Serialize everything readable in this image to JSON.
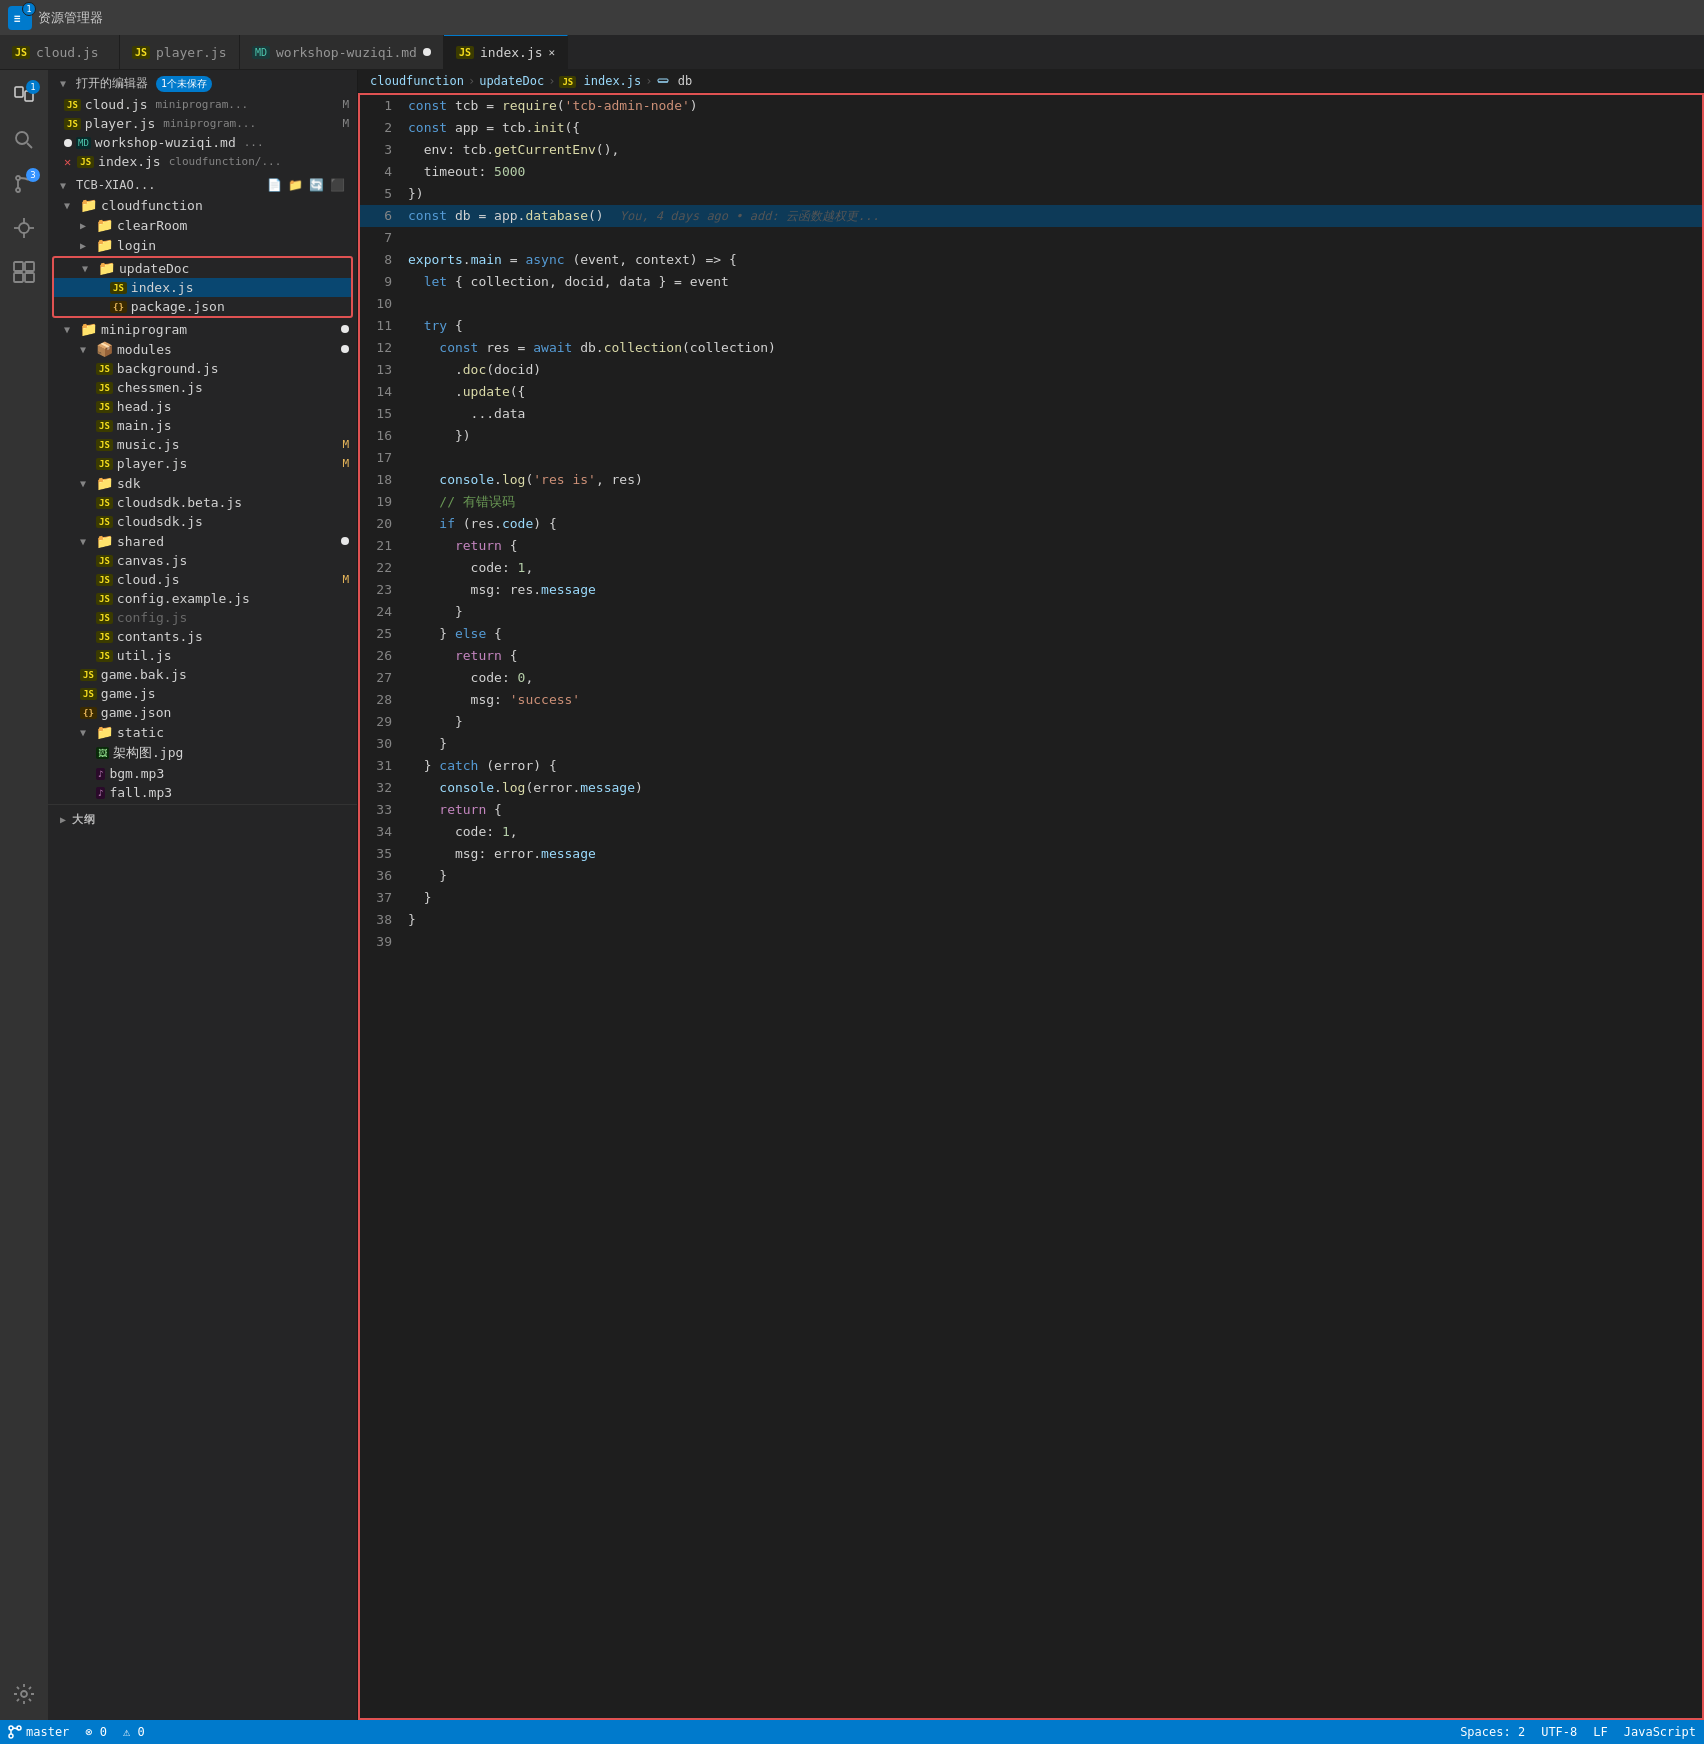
{
  "titleBar": {
    "appName": "资源管理器",
    "badge": "1"
  },
  "tabs": [
    {
      "id": "cloud",
      "icon": "JS",
      "label": "cloud.js",
      "active": false,
      "modified": false
    },
    {
      "id": "player",
      "icon": "JS",
      "label": "player.js",
      "active": false,
      "modified": false
    },
    {
      "id": "workshop",
      "icon": "MD",
      "label": "workshop-wuziqi.md",
      "active": false,
      "modified": true
    },
    {
      "id": "index",
      "icon": "JS",
      "label": "index.js",
      "active": true,
      "modified": false
    }
  ],
  "breadcrumb": {
    "items": [
      "cloudfunction",
      "updateDoc",
      "JS index.js",
      "db"
    ]
  },
  "sidebar": {
    "openEditors": {
      "label": "打开的编辑器",
      "badge": "1个未保存",
      "files": [
        {
          "icon": "JS",
          "name": "cloud.js",
          "path": "miniprogram..."
        },
        {
          "icon": "JS",
          "name": "player.js",
          "path": "miniprogram..."
        },
        {
          "icon": "MD",
          "name": "workshop-wuziqi.md",
          "path": "..."
        },
        {
          "icon": "JS",
          "name": "index.js",
          "path": "cloudfunction/..."
        }
      ]
    },
    "projectName": "TCB-XIAO...",
    "tree": [
      {
        "level": 1,
        "type": "folder",
        "name": "cloudfunction",
        "expanded": true
      },
      {
        "level": 2,
        "type": "folder",
        "name": "clearRoom",
        "expanded": false
      },
      {
        "level": 2,
        "type": "folder",
        "name": "login",
        "expanded": false
      },
      {
        "level": 2,
        "type": "folder-highlight",
        "name": "updateDoc",
        "expanded": true
      },
      {
        "level": 3,
        "type": "file-js",
        "name": "index.js",
        "modified": false,
        "active": true
      },
      {
        "level": 3,
        "type": "file-json",
        "name": "package.json",
        "modified": false
      },
      {
        "level": 1,
        "type": "folder",
        "name": "miniprogram",
        "expanded": true,
        "dot": true
      },
      {
        "level": 2,
        "type": "folder-special",
        "name": "modules",
        "expanded": true,
        "dot": true
      },
      {
        "level": 3,
        "type": "file-js",
        "name": "background.js",
        "modified": false
      },
      {
        "level": 3,
        "type": "file-js",
        "name": "chessmen.js",
        "modified": false
      },
      {
        "level": 3,
        "type": "file-js",
        "name": "head.js",
        "modified": false
      },
      {
        "level": 3,
        "type": "file-js",
        "name": "main.js",
        "modified": false
      },
      {
        "level": 3,
        "type": "file-js",
        "name": "music.js",
        "modified": true
      },
      {
        "level": 3,
        "type": "file-js",
        "name": "player.js",
        "modified": true
      },
      {
        "level": 2,
        "type": "folder",
        "name": "sdk",
        "expanded": true
      },
      {
        "level": 3,
        "type": "file-js",
        "name": "cloudsdk.beta.js",
        "modified": false
      },
      {
        "level": 3,
        "type": "file-js",
        "name": "cloudsdk.js",
        "modified": false
      },
      {
        "level": 2,
        "type": "folder",
        "name": "shared",
        "expanded": true,
        "dot": true
      },
      {
        "level": 3,
        "type": "file-js",
        "name": "canvas.js",
        "modified": false
      },
      {
        "level": 3,
        "type": "file-js",
        "name": "cloud.js",
        "modified": true
      },
      {
        "level": 3,
        "type": "file-js",
        "name": "config.example.js",
        "modified": false
      },
      {
        "level": 3,
        "type": "file-js",
        "name": "config.js",
        "modified": false,
        "dimmed": true
      },
      {
        "level": 3,
        "type": "file-js",
        "name": "contants.js",
        "modified": false
      },
      {
        "level": 3,
        "type": "file-js",
        "name": "util.js",
        "modified": false
      },
      {
        "level": 2,
        "type": "file-js",
        "name": "game.bak.js",
        "modified": false
      },
      {
        "level": 2,
        "type": "file-js",
        "name": "game.js",
        "modified": false
      },
      {
        "level": 2,
        "type": "file-json",
        "name": "game.json",
        "modified": false
      },
      {
        "level": 2,
        "type": "folder",
        "name": "static",
        "expanded": true
      },
      {
        "level": 3,
        "type": "file-img",
        "name": "架构图.jpg",
        "modified": false
      },
      {
        "level": 3,
        "type": "file-audio",
        "name": "bgm.mp3",
        "modified": false
      },
      {
        "level": 3,
        "type": "file-audio",
        "name": "fall.mp3",
        "modified": false
      }
    ]
  },
  "activityBar": {
    "items": [
      "explorer",
      "search",
      "git",
      "debug",
      "extensions",
      "settings"
    ]
  },
  "editor": {
    "inlineHint": "You, 4 days ago • add: 云函数越权更...",
    "lines": [
      {
        "num": 1,
        "tokens": [
          {
            "t": "kw",
            "v": "const"
          },
          {
            "t": "op",
            "v": " tcb = "
          },
          {
            "t": "fn",
            "v": "require"
          },
          {
            "t": "punc",
            "v": "("
          },
          {
            "t": "str",
            "v": "'tcb-admin-node'"
          },
          {
            "t": "punc",
            "v": ")"
          }
        ]
      },
      {
        "num": 2,
        "tokens": [
          {
            "t": "kw",
            "v": "const"
          },
          {
            "t": "op",
            "v": " app = tcb."
          },
          {
            "t": "fn",
            "v": "init"
          },
          {
            "t": "punc",
            "v": "({"
          }
        ]
      },
      {
        "num": 3,
        "tokens": [
          {
            "t": "op",
            "v": "  env: tcb."
          },
          {
            "t": "fn",
            "v": "getCurrentEnv"
          },
          {
            "t": "punc",
            "v": "(),"
          }
        ]
      },
      {
        "num": 4,
        "tokens": [
          {
            "t": "op",
            "v": "  timeout: "
          },
          {
            "t": "num",
            "v": "5000"
          }
        ]
      },
      {
        "num": 5,
        "tokens": [
          {
            "t": "punc",
            "v": "})"
          }
        ]
      },
      {
        "num": 6,
        "tokens": [
          {
            "t": "kw",
            "v": "const"
          },
          {
            "t": "op",
            "v": " db = app."
          },
          {
            "t": "fn",
            "v": "database"
          },
          {
            "t": "punc",
            "v": "()"
          }
        ],
        "hint": true
      },
      {
        "num": 7,
        "tokens": []
      },
      {
        "num": 8,
        "tokens": [
          {
            "t": "prop",
            "v": "exports"
          },
          {
            "t": "op",
            "v": "."
          },
          {
            "t": "prop",
            "v": "main"
          },
          {
            "t": "op",
            "v": " = "
          },
          {
            "t": "kw",
            "v": "async"
          },
          {
            "t": "op",
            "v": " (event, context) => {"
          }
        ]
      },
      {
        "num": 9,
        "tokens": [
          {
            "t": "op",
            "v": "  "
          },
          {
            "t": "kw",
            "v": "let"
          },
          {
            "t": "op",
            "v": " { collection, docid, data } = event"
          }
        ]
      },
      {
        "num": 10,
        "tokens": []
      },
      {
        "num": 11,
        "tokens": [
          {
            "t": "op",
            "v": "  "
          },
          {
            "t": "kw",
            "v": "try"
          },
          {
            "t": "op",
            "v": " {"
          }
        ]
      },
      {
        "num": 12,
        "tokens": [
          {
            "t": "op",
            "v": "    "
          },
          {
            "t": "kw",
            "v": "const"
          },
          {
            "t": "op",
            "v": " res = "
          },
          {
            "t": "kw",
            "v": "await"
          },
          {
            "t": "op",
            "v": " db."
          },
          {
            "t": "fn",
            "v": "collection"
          },
          {
            "t": "punc",
            "v": "("
          },
          {
            "t": "op",
            "v": "collection"
          },
          {
            "t": "punc",
            "v": ")"
          }
        ]
      },
      {
        "num": 13,
        "tokens": [
          {
            "t": "op",
            "v": "      ."
          },
          {
            "t": "fn",
            "v": "doc"
          },
          {
            "t": "punc",
            "v": "("
          },
          {
            "t": "op",
            "v": "docid"
          },
          {
            "t": "punc",
            "v": ")"
          }
        ]
      },
      {
        "num": 14,
        "tokens": [
          {
            "t": "op",
            "v": "      ."
          },
          {
            "t": "fn",
            "v": "update"
          },
          {
            "t": "punc",
            "v": "({"
          }
        ]
      },
      {
        "num": 15,
        "tokens": [
          {
            "t": "op",
            "v": "        ...data"
          }
        ]
      },
      {
        "num": 16,
        "tokens": [
          {
            "t": "punc",
            "v": "      })"
          }
        ]
      },
      {
        "num": 17,
        "tokens": []
      },
      {
        "num": 18,
        "tokens": [
          {
            "t": "op",
            "v": "    "
          },
          {
            "t": "prop",
            "v": "console"
          },
          {
            "t": "op",
            "v": "."
          },
          {
            "t": "fn",
            "v": "log"
          },
          {
            "t": "punc",
            "v": "("
          },
          {
            "t": "str",
            "v": "'res is'"
          },
          {
            "t": "op",
            "v": ", res"
          },
          {
            "t": "punc",
            "v": ")"
          }
        ]
      },
      {
        "num": 19,
        "tokens": [
          {
            "t": "comment",
            "v": "    // 有错误码"
          }
        ]
      },
      {
        "num": 20,
        "tokens": [
          {
            "t": "op",
            "v": "    "
          },
          {
            "t": "kw",
            "v": "if"
          },
          {
            "t": "op",
            "v": " (res."
          },
          {
            "t": "prop",
            "v": "code"
          },
          {
            "t": "op",
            "v": ") {"
          }
        ]
      },
      {
        "num": 21,
        "tokens": [
          {
            "t": "op",
            "v": "      "
          },
          {
            "t": "kw2",
            "v": "return"
          },
          {
            "t": "op",
            "v": " {"
          }
        ]
      },
      {
        "num": 22,
        "tokens": [
          {
            "t": "op",
            "v": "        code: "
          },
          {
            "t": "num",
            "v": "1"
          },
          {
            "t": "op",
            "v": ","
          }
        ]
      },
      {
        "num": 23,
        "tokens": [
          {
            "t": "op",
            "v": "        msg: res."
          },
          {
            "t": "prop",
            "v": "message"
          }
        ]
      },
      {
        "num": 24,
        "tokens": [
          {
            "t": "op",
            "v": "      }"
          }
        ]
      },
      {
        "num": 25,
        "tokens": [
          {
            "t": "op",
            "v": "    } "
          },
          {
            "t": "kw",
            "v": "else"
          },
          {
            "t": "op",
            "v": " {"
          }
        ]
      },
      {
        "num": 26,
        "tokens": [
          {
            "t": "op",
            "v": "      "
          },
          {
            "t": "kw2",
            "v": "return"
          },
          {
            "t": "op",
            "v": " {"
          }
        ]
      },
      {
        "num": 27,
        "tokens": [
          {
            "t": "op",
            "v": "        code: "
          },
          {
            "t": "num",
            "v": "0"
          },
          {
            "t": "op",
            "v": ","
          }
        ]
      },
      {
        "num": 28,
        "tokens": [
          {
            "t": "op",
            "v": "        msg: "
          },
          {
            "t": "str",
            "v": "'success'"
          }
        ]
      },
      {
        "num": 29,
        "tokens": [
          {
            "t": "op",
            "v": "      }"
          }
        ]
      },
      {
        "num": 30,
        "tokens": [
          {
            "t": "op",
            "v": "    }"
          }
        ]
      },
      {
        "num": 31,
        "tokens": [
          {
            "t": "op",
            "v": "  } "
          },
          {
            "t": "kw",
            "v": "catch"
          },
          {
            "t": "op",
            "v": " (error) {"
          }
        ]
      },
      {
        "num": 32,
        "tokens": [
          {
            "t": "op",
            "v": "    "
          },
          {
            "t": "prop",
            "v": "console"
          },
          {
            "t": "op",
            "v": "."
          },
          {
            "t": "fn",
            "v": "log"
          },
          {
            "t": "punc",
            "v": "("
          },
          {
            "t": "op",
            "v": "error."
          },
          {
            "t": "prop",
            "v": "message"
          },
          {
            "t": "punc",
            "v": ")"
          }
        ]
      },
      {
        "num": 33,
        "tokens": [
          {
            "t": "op",
            "v": "    "
          },
          {
            "t": "kw2",
            "v": "return"
          },
          {
            "t": "op",
            "v": " {"
          }
        ]
      },
      {
        "num": 34,
        "tokens": [
          {
            "t": "op",
            "v": "      code: "
          },
          {
            "t": "num",
            "v": "1"
          },
          {
            "t": "op",
            "v": ","
          }
        ]
      },
      {
        "num": 35,
        "tokens": [
          {
            "t": "op",
            "v": "      msg: error."
          },
          {
            "t": "prop",
            "v": "message"
          }
        ]
      },
      {
        "num": 36,
        "tokens": [
          {
            "t": "op",
            "v": "    }"
          }
        ]
      },
      {
        "num": 37,
        "tokens": [
          {
            "t": "op",
            "v": "  }"
          }
        ]
      },
      {
        "num": 38,
        "tokens": [
          {
            "t": "op",
            "v": "}"
          }
        ]
      },
      {
        "num": 39,
        "tokens": []
      }
    ]
  },
  "statusBar": {
    "gitBranch": "master",
    "errors": "0",
    "warnings": "0",
    "language": "JavaScript",
    "encoding": "UTF-8",
    "lineEnding": "LF",
    "spaces": "Spaces: 2"
  },
  "bottomBar": {
    "label": "大纲",
    "chevron": "▶"
  }
}
